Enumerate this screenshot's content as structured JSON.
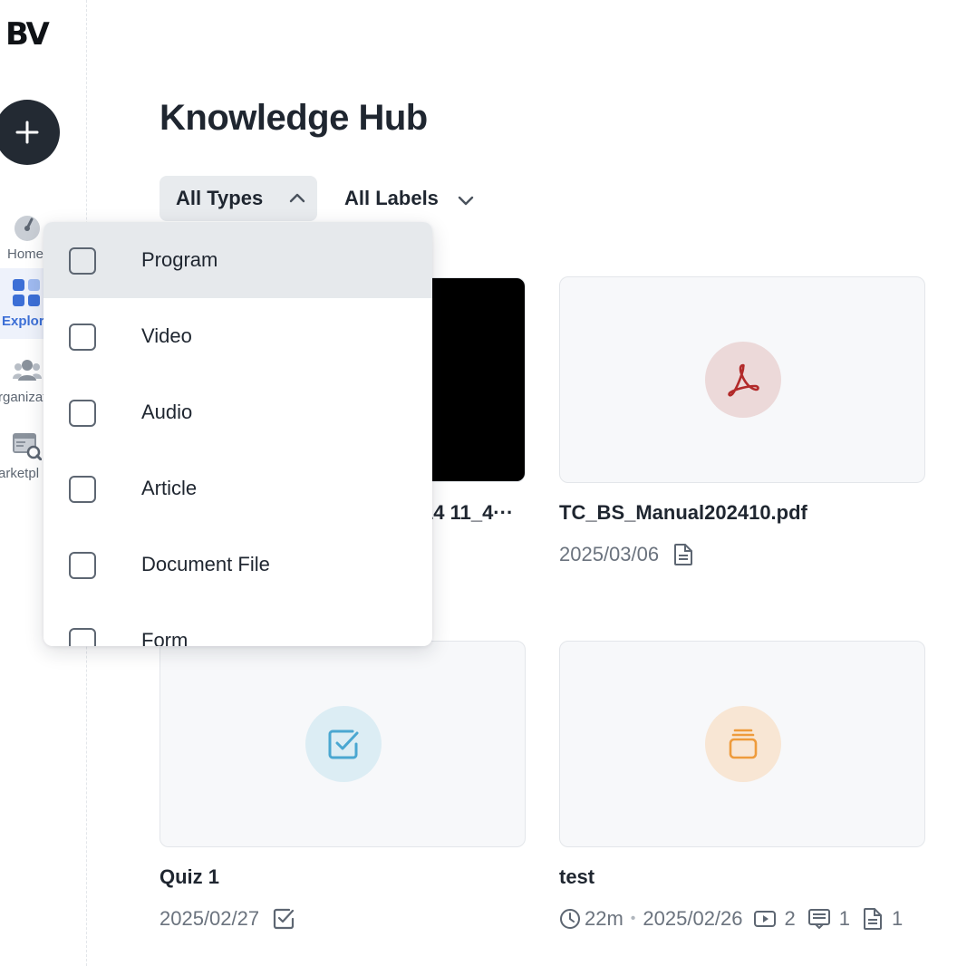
{
  "app": {
    "logo": "BV",
    "title": "Knowledge Hub"
  },
  "sidebar": {
    "items": [
      {
        "label": "Home",
        "icon": "gauge-icon",
        "active": false
      },
      {
        "label": "Explor",
        "icon": "apps-grid-icon",
        "active": true
      },
      {
        "label": "rganizat",
        "icon": "people-group-icon",
        "active": false
      },
      {
        "label": "arketpl",
        "icon": "browser-search-icon",
        "active": false
      }
    ]
  },
  "filters": {
    "types_label": "All Types",
    "labels_label": "All Labels"
  },
  "dropdown": {
    "options": [
      {
        "label": "Program",
        "checked": false
      },
      {
        "label": "Video",
        "checked": false
      },
      {
        "label": "Audio",
        "checked": false
      },
      {
        "label": "Article",
        "checked": false
      },
      {
        "label": "Document File",
        "checked": false
      },
      {
        "label": "Form",
        "checked": false
      }
    ]
  },
  "cards": [
    {
      "title": "14 11_4···",
      "type": "video"
    },
    {
      "title": "TC_BS_Manual202410.pdf",
      "date": "2025/03/06",
      "icon": "pdf-icon",
      "meta_icon": "document-icon"
    },
    {
      "title": "Quiz 1",
      "date": "2025/02/27",
      "icon": "checkbox-icon",
      "meta_icon": "checkbox-icon"
    },
    {
      "title": "test",
      "duration": "22m",
      "separator": "•",
      "date": "2025/02/26",
      "icon": "stack-icon",
      "counts": {
        "video": "2",
        "article": "1",
        "document": "1"
      }
    }
  ],
  "colors": {
    "accent": "#3c6fd6",
    "fab": "#232a33",
    "pdf_red": "#b22a2a",
    "pdf_bg": "#ecd9d9",
    "quiz_blue": "#4aa7d1",
    "quiz_bg": "#dcedf4",
    "program_orange": "#ee9b3c",
    "program_bg": "#f8e6d4"
  }
}
